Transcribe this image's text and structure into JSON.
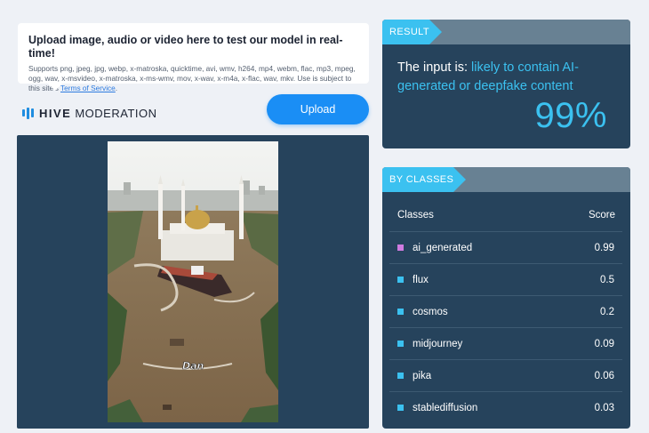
{
  "upload": {
    "heading": "Upload image, audio or video here to test our model in real-time!",
    "supported_text": "Supports png, jpeg, jpg, webp, x-matroska, quicktime, avi, wmv, h264, mp4, webm, flac, mp3, mpeg, ogg, wav, x-msvideo, x-matroska, x-ms-wmv, mov, x-wav, x-m4a, x-flac, wav, mkv. Use is subject to this site's ",
    "terms_link": "Terms of Service",
    "terms_suffix": ".",
    "button_label": "Upload"
  },
  "brand": {
    "name_bold": "HIVE",
    "name_light": "MODERATION",
    "icon": "hive-logo-icon"
  },
  "preview": {
    "watermark": "Dan"
  },
  "result": {
    "header": "RESULT",
    "prefix": "The input is: ",
    "verdict": "likely to contain AI-generated or deepfake content",
    "score": "99%"
  },
  "classes": {
    "header": "BY CLASSES",
    "col_class": "Classes",
    "col_score": "Score",
    "items": [
      {
        "label": "ai_generated",
        "score": "0.99",
        "color": "#d07be0"
      },
      {
        "label": "flux",
        "score": "0.5",
        "color": "#3bc1f0"
      },
      {
        "label": "cosmos",
        "score": "0.2",
        "color": "#3bc1f0"
      },
      {
        "label": "midjourney",
        "score": "0.09",
        "color": "#3bc1f0"
      },
      {
        "label": "pika",
        "score": "0.06",
        "color": "#3bc1f0"
      },
      {
        "label": "stablediffusion",
        "score": "0.03",
        "color": "#3bc1f0"
      }
    ]
  },
  "colors": {
    "accent": "#3bc1f0",
    "panel": "#26435c",
    "header_bar": "#688193",
    "upload_button": "#1a8ef5"
  }
}
